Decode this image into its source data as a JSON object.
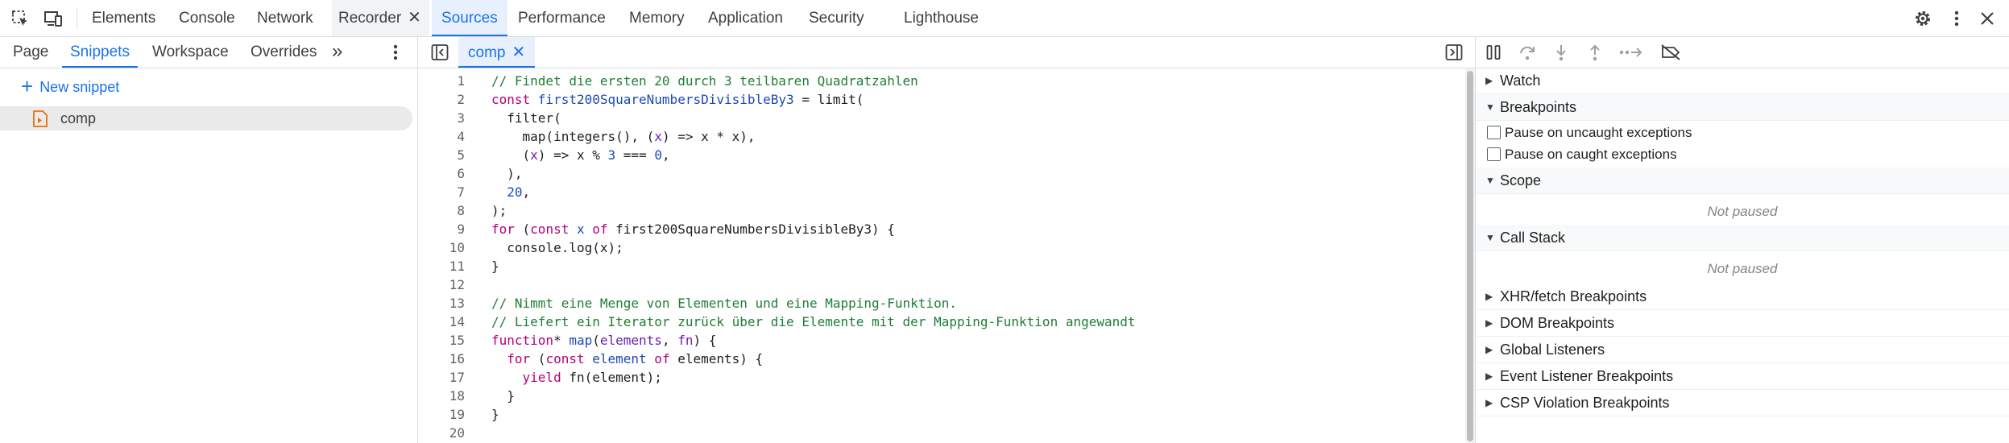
{
  "toolbar": {
    "tabs": [
      {
        "label": "Elements"
      },
      {
        "label": "Console"
      },
      {
        "label": "Network"
      },
      {
        "label": "Recorder"
      },
      {
        "label": "Sources"
      },
      {
        "label": "Performance"
      },
      {
        "label": "Memory"
      },
      {
        "label": "Application"
      },
      {
        "label": "Security"
      },
      {
        "label": "Lighthouse"
      }
    ],
    "close_glyph": "✕",
    "accent": "#1a73e8"
  },
  "navigator": {
    "tabs": [
      "Page",
      "Snippets",
      "Workspace",
      "Overrides"
    ],
    "more_glyph": "»",
    "new_snippet": "New snippet",
    "snippets": [
      {
        "name": "comp"
      }
    ]
  },
  "editor": {
    "file_tab": "comp",
    "close_glyph": "✕",
    "lines": [
      {
        "n": "1",
        "parts": [
          {
            "t": "// Findet die ersten 20 durch 3 teilbaren Quadratzahlen",
            "c": "cm"
          }
        ]
      },
      {
        "n": "2",
        "parts": [
          {
            "t": "const ",
            "c": "kw"
          },
          {
            "t": "first200SquareNumbersDivisibleBy3",
            "c": "df"
          },
          {
            "t": " = limit(",
            "c": ""
          }
        ]
      },
      {
        "n": "3",
        "parts": [
          {
            "t": "  filter(",
            "c": ""
          }
        ]
      },
      {
        "n": "4",
        "parts": [
          {
            "t": "    map(integers(), (",
            "c": ""
          },
          {
            "t": "x",
            "c": "vr"
          },
          {
            "t": ") => x * x),",
            "c": ""
          }
        ]
      },
      {
        "n": "5",
        "parts": [
          {
            "t": "    (",
            "c": ""
          },
          {
            "t": "x",
            "c": "vr"
          },
          {
            "t": ") => x % ",
            "c": ""
          },
          {
            "t": "3",
            "c": "nm"
          },
          {
            "t": " === ",
            "c": ""
          },
          {
            "t": "0",
            "c": "nm"
          },
          {
            "t": ",",
            "c": ""
          }
        ]
      },
      {
        "n": "6",
        "parts": [
          {
            "t": "  ),",
            "c": ""
          }
        ]
      },
      {
        "n": "7",
        "parts": [
          {
            "t": "  ",
            "c": ""
          },
          {
            "t": "20",
            "c": "nm"
          },
          {
            "t": ",",
            "c": ""
          }
        ]
      },
      {
        "n": "8",
        "parts": [
          {
            "t": ");",
            "c": ""
          }
        ]
      },
      {
        "n": "9",
        "parts": [
          {
            "t": "for",
            "c": "kw"
          },
          {
            "t": " (",
            "c": ""
          },
          {
            "t": "const ",
            "c": "kw"
          },
          {
            "t": "x",
            "c": "df"
          },
          {
            "t": " of ",
            "c": "kw"
          },
          {
            "t": "first200SquareNumbersDivisibleBy3) {",
            "c": ""
          }
        ]
      },
      {
        "n": "10",
        "parts": [
          {
            "t": "  console.log(x);",
            "c": ""
          }
        ]
      },
      {
        "n": "11",
        "parts": [
          {
            "t": "}",
            "c": ""
          }
        ]
      },
      {
        "n": "12",
        "parts": []
      },
      {
        "n": "13",
        "parts": [
          {
            "t": "// Nimmt eine Menge von Elementen und eine Mapping-Funktion.",
            "c": "cm"
          }
        ]
      },
      {
        "n": "14",
        "parts": [
          {
            "t": "// Liefert ein Iterator zurück über die Elemente mit der Mapping-Funktion angewandt",
            "c": "cm"
          }
        ]
      },
      {
        "n": "15",
        "parts": [
          {
            "t": "function",
            "c": "kw"
          },
          {
            "t": "* ",
            "c": ""
          },
          {
            "t": "map",
            "c": "df"
          },
          {
            "t": "(",
            "c": ""
          },
          {
            "t": "elements",
            "c": "vr"
          },
          {
            "t": ", ",
            "c": ""
          },
          {
            "t": "fn",
            "c": "vr"
          },
          {
            "t": ") {",
            "c": ""
          }
        ]
      },
      {
        "n": "16",
        "parts": [
          {
            "t": "  for",
            "c": "kw"
          },
          {
            "t": " (",
            "c": ""
          },
          {
            "t": "const ",
            "c": "kw"
          },
          {
            "t": "element",
            "c": "df"
          },
          {
            "t": " of ",
            "c": "kw"
          },
          {
            "t": "elements) {",
            "c": ""
          }
        ]
      },
      {
        "n": "17",
        "parts": [
          {
            "t": "    yield",
            "c": "kw"
          },
          {
            "t": " fn(element);",
            "c": ""
          }
        ]
      },
      {
        "n": "18",
        "parts": [
          {
            "t": "  }",
            "c": ""
          }
        ]
      },
      {
        "n": "19",
        "parts": [
          {
            "t": "}",
            "c": ""
          }
        ]
      },
      {
        "n": "20",
        "parts": []
      }
    ]
  },
  "debugger": {
    "sections": {
      "watch": "Watch",
      "breakpoints": "Breakpoints",
      "pause_uncaught": "Pause on uncaught exceptions",
      "pause_caught": "Pause on caught exceptions",
      "scope": "Scope",
      "scope_status": "Not paused",
      "call_stack": "Call Stack",
      "call_stack_status": "Not paused",
      "xhr": "XHR/fetch Breakpoints",
      "dom": "DOM Breakpoints",
      "global": "Global Listeners",
      "event": "Event Listener Breakpoints",
      "csp": "CSP Violation Breakpoints"
    },
    "expanded_glyph": "▼",
    "collapsed_glyph": "▶"
  }
}
